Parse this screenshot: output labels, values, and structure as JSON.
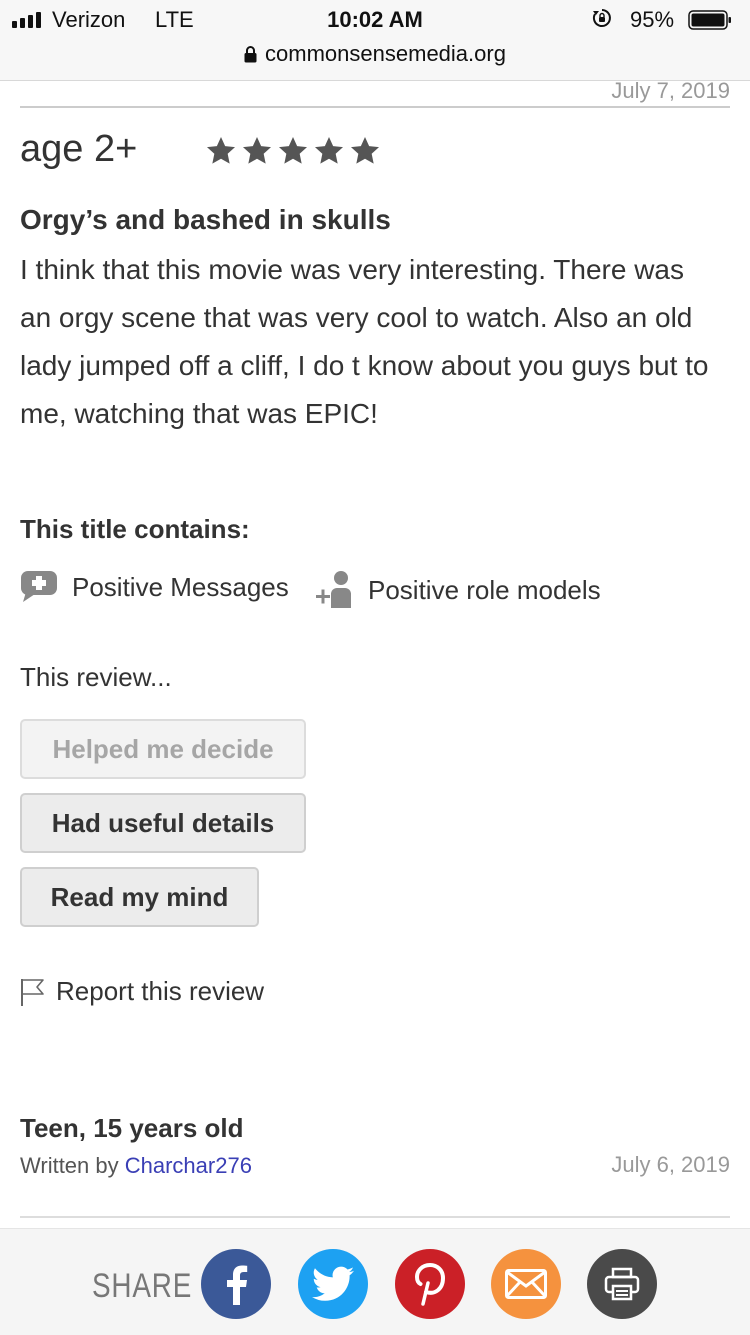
{
  "status_bar": {
    "carrier": "Verizon",
    "network": "LTE",
    "time": "10:02 AM",
    "battery_percent": "95%"
  },
  "url_bar": {
    "url": "commonsensemedia.org"
  },
  "previous_review": {
    "date": "July 7, 2019"
  },
  "review": {
    "age": "age 2+",
    "rating_stars": 5,
    "title": "Orgy’s and bashed in skulls",
    "body": "I think that this movie was very interesting. There was an orgy scene that was very cool to watch. Also an old lady jumped off a cliff, I do t know about you guys but to me, watching that was EPIC!",
    "contains_label": "This title contains:",
    "attributes": [
      {
        "label": "Positive Messages",
        "icon": "speech-bubble-plus-icon"
      },
      {
        "label": "Positive role models",
        "icon": "person-plus-icon"
      }
    ],
    "feedback_label": "This review...",
    "feedback_buttons": [
      "Helped me decide",
      "Had useful details",
      "Read my mind"
    ],
    "report_label": "Report this review"
  },
  "next_review": {
    "author_age": "Teen, 15 years old",
    "written_by_label": "Written by",
    "author_name": "Charchar276",
    "date": "July 6, 2019"
  },
  "share_bar": {
    "label": "SHARE",
    "buttons": [
      {
        "name": "facebook",
        "icon": "facebook-icon",
        "color": "#3b5998"
      },
      {
        "name": "twitter",
        "icon": "twitter-icon",
        "color": "#1da1f2"
      },
      {
        "name": "pinterest",
        "icon": "pinterest-icon",
        "color": "#cb2027"
      },
      {
        "name": "email",
        "icon": "mail-icon",
        "color": "#f5923e"
      },
      {
        "name": "print",
        "icon": "printer-icon",
        "color": "#4a4a4a"
      }
    ]
  },
  "colors": {
    "link": "#3a3fb5",
    "text": "#333333",
    "muted": "#999999"
  }
}
